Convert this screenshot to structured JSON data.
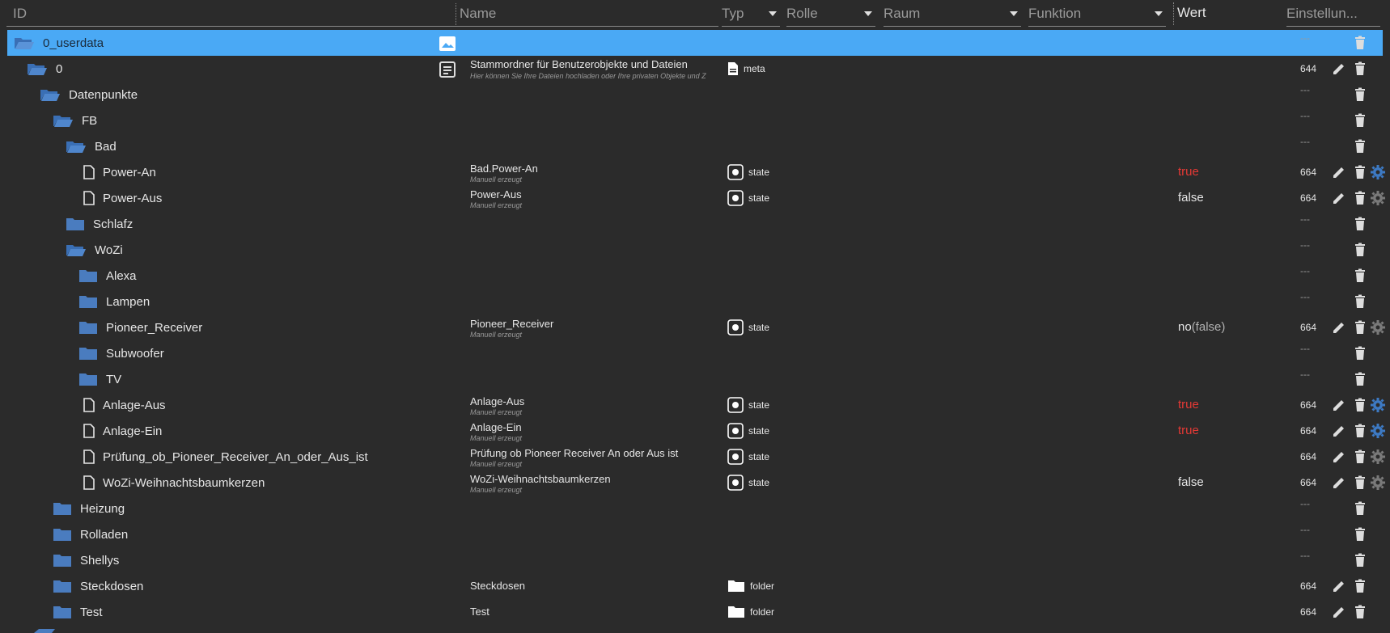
{
  "header": {
    "id": "ID",
    "name": "Name",
    "typ": "Typ",
    "rolle": "Rolle",
    "raum": "Raum",
    "funktion": "Funktion",
    "wert": "Wert",
    "einstellungen": "Einstellun..."
  },
  "colors": {
    "selected_row": "#4aa9f5",
    "folder": "#4a7cbf",
    "true_value": "#e53935",
    "gear_active": "#3d7ac4",
    "gear_inactive": "#7a7a7a"
  },
  "rows": [
    {
      "id": "0_userdata",
      "selected": true,
      "perm": "---"
    },
    {
      "id": "0",
      "name": "Stammordner für Benutzerobjekte und Dateien",
      "sub": "Hier können Sie Ihre Dateien hochladen oder Ihre privaten Objekte und Z",
      "type": "meta",
      "perm": "644"
    },
    {
      "id": "Datenpunkte",
      "perm": "---"
    },
    {
      "id": "FB",
      "perm": "---"
    },
    {
      "id": "Bad",
      "perm": "---"
    },
    {
      "id": "Power-An",
      "name": "Bad.Power-An",
      "sub": "Manuell erzeugt",
      "type": "state",
      "wert": "true",
      "perm": "664"
    },
    {
      "id": "Power-Aus",
      "name": "Power-Aus",
      "sub": "Manuell erzeugt",
      "type": "state",
      "wert": "false",
      "perm": "664"
    },
    {
      "id": "Schlafz",
      "perm": "---"
    },
    {
      "id": "WoZi",
      "perm": "---"
    },
    {
      "id": "Alexa",
      "perm": "---"
    },
    {
      "id": "Lampen",
      "perm": "---"
    },
    {
      "id": "Pioneer_Receiver",
      "name": "Pioneer_Receiver",
      "sub": "Manuell erzeugt",
      "type": "state",
      "wert_main": "no",
      "wert_extra": "(false)",
      "perm": "664"
    },
    {
      "id": "Subwoofer",
      "perm": "---"
    },
    {
      "id": "TV",
      "perm": "---"
    },
    {
      "id": "Anlage-Aus",
      "name": "Anlage-Aus",
      "sub": "Manuell erzeugt",
      "type": "state",
      "wert": "true",
      "perm": "664"
    },
    {
      "id": "Anlage-Ein",
      "name": "Anlage-Ein",
      "sub": "Manuell erzeugt",
      "type": "state",
      "wert": "true",
      "perm": "664"
    },
    {
      "id": "Prüfung_ob_Pioneer_Receiver_An_oder_Aus_ist",
      "name": "Prüfung ob Pioneer Receiver An oder Aus ist",
      "sub": "Manuell erzeugt",
      "type": "state",
      "perm": "664"
    },
    {
      "id": "WoZi-Weihnachtsbaumkerzen",
      "name": "WoZi-Weihnachtsbaumkerzen",
      "sub": "Manuell erzeugt",
      "type": "state",
      "wert": "false",
      "perm": "664"
    },
    {
      "id": "Heizung",
      "perm": "---"
    },
    {
      "id": "Rolladen",
      "perm": "---"
    },
    {
      "id": "Shellys",
      "perm": "---"
    },
    {
      "id": "Steckdosen",
      "name": "Steckdosen",
      "type": "folder",
      "perm": "664"
    },
    {
      "id": "Test",
      "name": "Test",
      "type": "folder",
      "perm": "664"
    }
  ]
}
